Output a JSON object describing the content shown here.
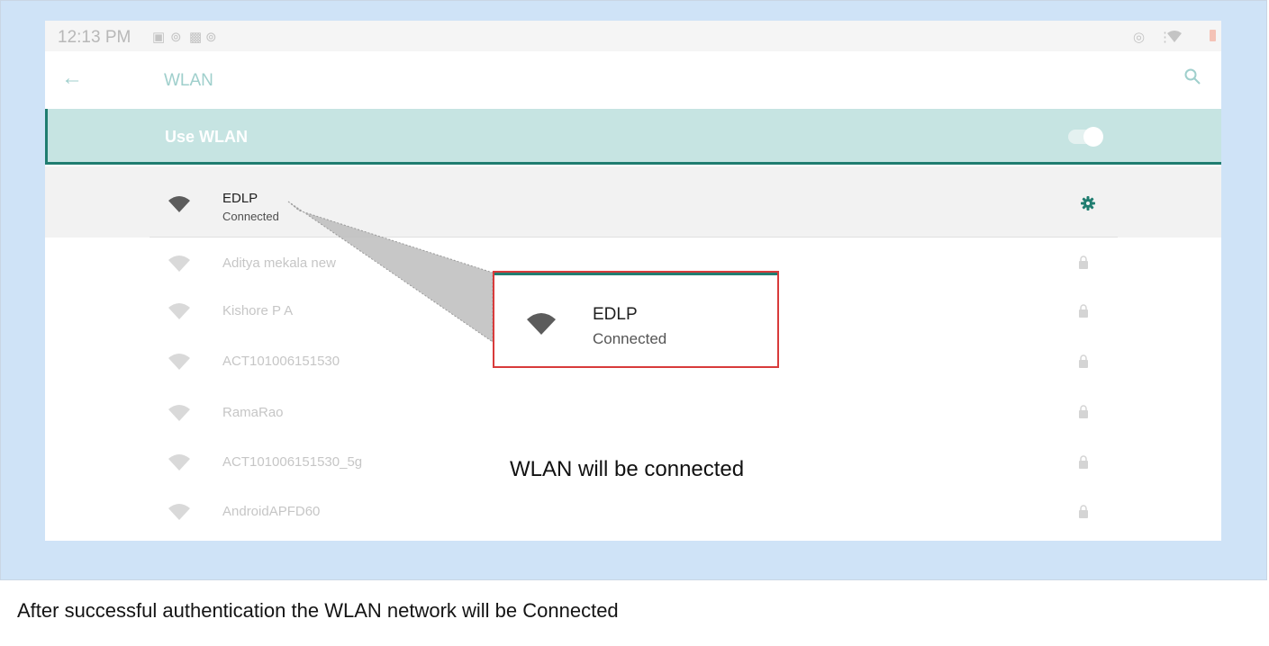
{
  "status_bar": {
    "time": "12:13 PM",
    "icons": [
      "notification-icon",
      "sync-icon",
      "sd-card-icon",
      "sync-icon"
    ],
    "right_icons": [
      "vibrate-icon",
      "wifi-icon",
      "battery-icon"
    ]
  },
  "app_bar": {
    "title": "WLAN",
    "back_icon": "arrow-back-icon",
    "search_icon": "search-icon"
  },
  "use_wlan": {
    "label": "Use WLAN",
    "enabled": true
  },
  "connected_network": {
    "name": "EDLP",
    "status": "Connected",
    "settings_icon": "gear-icon"
  },
  "networks": [
    {
      "name": "Aditya mekala  new",
      "locked": true
    },
    {
      "name": "Kishore P A",
      "locked": true
    },
    {
      "name": "ACT101006151530",
      "locked": true
    },
    {
      "name": "RamaRao",
      "locked": true
    },
    {
      "name": "ACT101006151530_5g",
      "locked": true
    },
    {
      "name": "AndroidAPFD60",
      "locked": true
    }
  ],
  "callout": {
    "name": "EDLP",
    "status": "Connected",
    "caption": "WLAN will be connected"
  },
  "footer": {
    "caption": "After successful authentication the WLAN network will be Connected"
  },
  "colors": {
    "accent": "#207d70",
    "toggle_row": "#c6e4e2",
    "frame": "#cfe3f7",
    "callout_border": "#d83b3b"
  }
}
